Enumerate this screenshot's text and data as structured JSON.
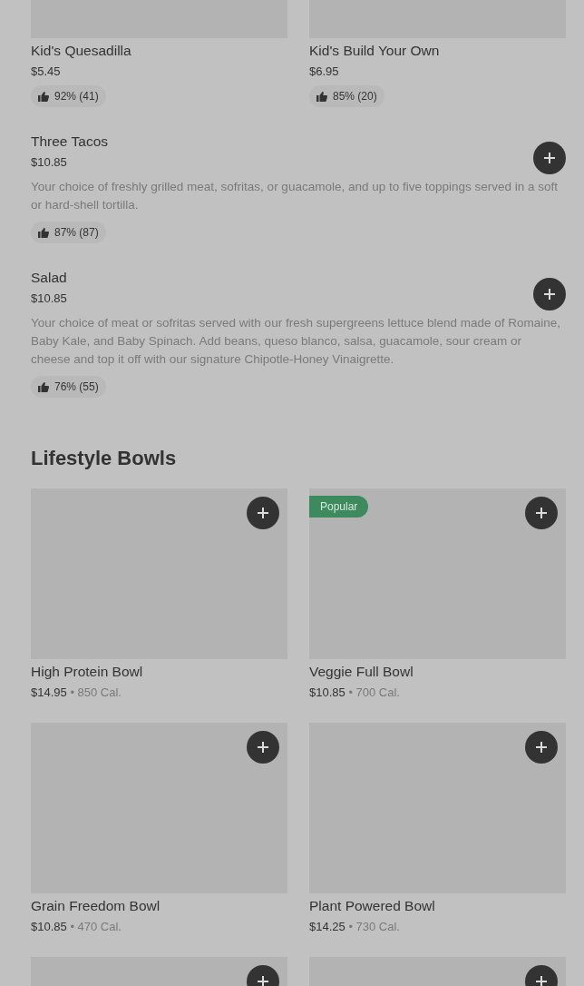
{
  "kids_items": [
    {
      "name": "Kid's Quesadilla",
      "price": "$5.45",
      "rating": "92% (41)"
    },
    {
      "name": "Kid's Build Your Own",
      "price": "$6.95",
      "rating": "85% (20)"
    }
  ],
  "list_items": [
    {
      "name": "Three Tacos",
      "price": "$10.85",
      "description": "Your choice of freshly grilled meat, sofritas, or guacamole, and up to five toppings served in a soft or hard-shell tortilla.",
      "rating": "87% (87)"
    },
    {
      "name": "Salad",
      "price": "$10.85",
      "description": "Your choice of meat or sofritas served with our fresh supergreens lettuce blend made of Romaine, Baby Kale, and Baby Spinach. Add beans, queso blanco, salsa, guacamole, sour cream or cheese and top it off with our signature Chipotle-Honey Vinaigrette.",
      "rating": "76% (55)"
    }
  ],
  "section": {
    "title": "Lifestyle Bowls",
    "rows": [
      {
        "cards": [
          {
            "kind": "bowl",
            "name": "High Protein Bowl",
            "price": "$14.95",
            "calories": "• 850 Cal."
          },
          {
            "kind": "bowl",
            "name": "Veggie Full Bowl",
            "price": "$10.85",
            "calories": "• 700 Cal.",
            "badge": "Popular"
          }
        ]
      },
      {
        "cards": [
          {
            "kind": "bowl",
            "name": "Grain Freedom Bowl",
            "price": "$10.85",
            "calories": "• 470 Cal."
          },
          {
            "kind": "bowl",
            "name": "Plant Powered Bowl",
            "price": "$14.25",
            "calories": "• 730 Cal."
          }
        ]
      },
      {
        "cards": [
          {
            "kind": "cut"
          },
          {
            "kind": "cut"
          }
        ]
      }
    ]
  }
}
